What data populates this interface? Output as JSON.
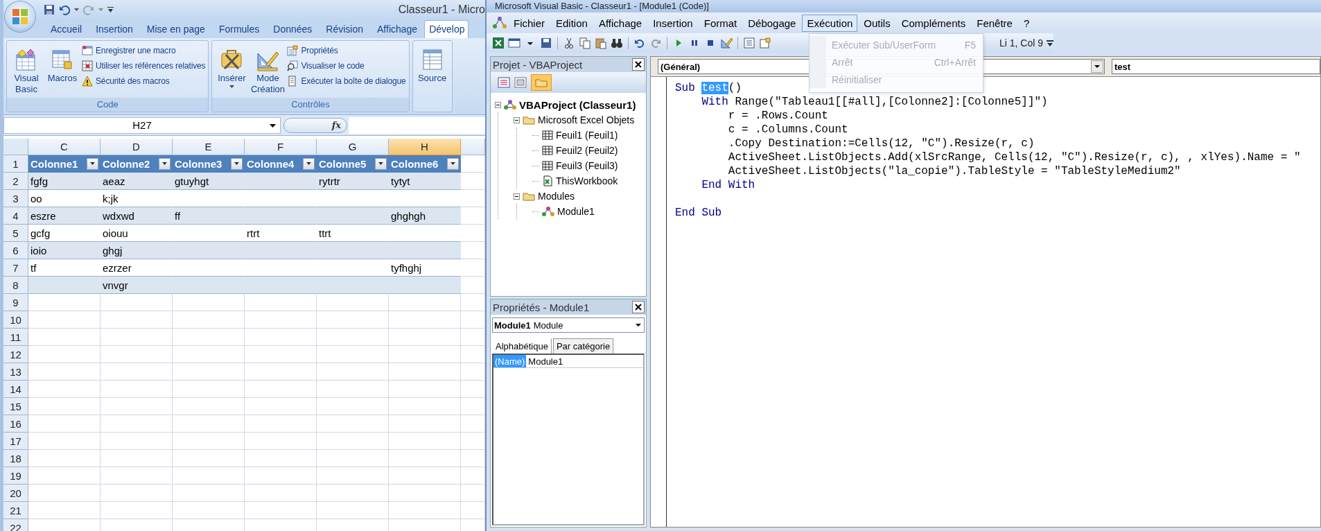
{
  "excel": {
    "title": "Classeur1 - Micro",
    "tabs": [
      {
        "label": "Accueil",
        "selected": false
      },
      {
        "label": "Insertion",
        "selected": false
      },
      {
        "label": "Mise en page",
        "selected": false
      },
      {
        "label": "Formules",
        "selected": false
      },
      {
        "label": "Données",
        "selected": false
      },
      {
        "label": "Révision",
        "selected": false
      },
      {
        "label": "Affichage",
        "selected": false
      },
      {
        "label": "Dévelop",
        "selected": true
      }
    ],
    "groups": [
      {
        "title": "Code",
        "large": [
          {
            "label": "Visual Basic",
            "kind": "vba"
          },
          {
            "label": "Macros",
            "kind": "macros"
          }
        ],
        "small": [
          {
            "label": "Enregistrer une macro",
            "kind": "record"
          },
          {
            "label": "Utiliser les références relatives",
            "kind": "relative"
          },
          {
            "label": "Sécurité des macros",
            "kind": "security"
          }
        ]
      },
      {
        "title": "Contrôles",
        "large": [
          {
            "label": "Insérer",
            "kind": "insert",
            "menu": true
          },
          {
            "label": "Mode Création",
            "kind": "design",
            "menu": false
          }
        ],
        "small": [
          {
            "label": "Propriétés",
            "kind": "properties"
          },
          {
            "label": "Visualiser le code",
            "kind": "view-code"
          },
          {
            "label": "Exécuter la boîte de dialogue",
            "kind": "dialog"
          }
        ]
      },
      {
        "large": [
          {
            "label": "Source",
            "kind": "source"
          }
        ]
      }
    ],
    "name_box": "H27",
    "formula_label": "fx",
    "sheet": {
      "columns": [
        {
          "label": "C",
          "selected": false
        },
        {
          "label": "D",
          "selected": false
        },
        {
          "label": "E",
          "selected": false
        },
        {
          "label": "F",
          "selected": false
        },
        {
          "label": "G",
          "selected": false
        },
        {
          "label": "H",
          "selected": true
        }
      ],
      "rows": [
        {
          "number": "1",
          "kind": "table-header",
          "cells": [
            "Colonne1",
            "Colonne2",
            "Colonne3",
            "Colonne4",
            "Colonne5",
            "Colonne6"
          ]
        },
        {
          "number": "2",
          "kind": "table-row",
          "banded": true,
          "cells": [
            "fgfg",
            "aeaz",
            "gtuyhgt",
            null,
            "rytrtr",
            "tytyt"
          ]
        },
        {
          "number": "3",
          "kind": "table-row",
          "banded": false,
          "cells": [
            "oo",
            "k;jk",
            null,
            null,
            null,
            null
          ]
        },
        {
          "number": "4",
          "kind": "table-row",
          "banded": true,
          "cells": [
            "eszre",
            "wdxwd",
            "ff",
            null,
            null,
            "ghghgh"
          ]
        },
        {
          "number": "5",
          "kind": "table-row",
          "banded": false,
          "cells": [
            "gcfg",
            "oiouu",
            null,
            "rtrt",
            "ttrt",
            null
          ]
        },
        {
          "number": "6",
          "kind": "table-row",
          "banded": true,
          "cells": [
            "ioio",
            "ghgj",
            null,
            null,
            null,
            null
          ]
        },
        {
          "number": "7",
          "kind": "table-row",
          "banded": false,
          "cells": [
            "tf",
            "ezrzer",
            null,
            null,
            null,
            "tyfhghj"
          ]
        },
        {
          "number": "8",
          "kind": "table-row",
          "banded": true,
          "cells": [
            null,
            "vnvgr",
            null,
            null,
            null,
            null
          ]
        },
        {
          "number": "9",
          "kind": "empty"
        },
        {
          "number": "10",
          "kind": "empty"
        },
        {
          "number": "11",
          "kind": "empty"
        },
        {
          "number": "12",
          "kind": "empty"
        },
        {
          "number": "13",
          "kind": "empty"
        },
        {
          "number": "14",
          "kind": "empty"
        },
        {
          "number": "15",
          "kind": "empty"
        },
        {
          "number": "16",
          "kind": "empty"
        },
        {
          "number": "17",
          "kind": "empty"
        },
        {
          "number": "18",
          "kind": "empty"
        },
        {
          "number": "19",
          "kind": "empty"
        },
        {
          "number": "20",
          "kind": "empty"
        },
        {
          "number": "21",
          "kind": "empty"
        },
        {
          "number": "22",
          "kind": "empty"
        }
      ]
    }
  },
  "vbe": {
    "title": "Microsoft Visual Basic - Classeur1 - [Module1 (Code)]",
    "menus": [
      {
        "label": "Fichier",
        "selected": false
      },
      {
        "label": "Edition",
        "selected": false
      },
      {
        "label": "Affichage",
        "selected": false
      },
      {
        "label": "Insertion",
        "selected": false
      },
      {
        "label": "Format",
        "selected": false
      },
      {
        "label": "Débogage",
        "selected": false
      },
      {
        "label": "Exécution",
        "selected": true
      },
      {
        "label": "Outils",
        "selected": false
      },
      {
        "label": "Compléments",
        "selected": false
      },
      {
        "label": "Fenêtre",
        "selected": false
      },
      {
        "label": "?",
        "selected": false
      }
    ],
    "open_menu": [
      {
        "label": "Exécuter Sub/UserForm",
        "shortcut": "F5"
      },
      {
        "label": "Arrêt",
        "shortcut": "Ctrl+Arrêt"
      },
      {
        "label": "Réinitialiser"
      }
    ],
    "position": "Li 1, Col 9",
    "project": {
      "title": "Projet - VBAProject",
      "folders_toggled": true,
      "tree": [
        {
          "label": "VBAProject (Classeur1)",
          "kind": "project",
          "expanded": true,
          "children": [
            {
              "label": "Microsoft Excel Objets",
              "kind": "folder",
              "expanded": true,
              "children": [
                {
                  "label": "Feuil1 (Feuil1)",
                  "kind": "sheet"
                },
                {
                  "label": "Feuil2 (Feuil2)",
                  "kind": "sheet"
                },
                {
                  "label": "Feuil3 (Feuil3)",
                  "kind": "sheet"
                },
                {
                  "label": "ThisWorkbook",
                  "kind": "workbook"
                }
              ]
            },
            {
              "label": "Modules",
              "kind": "folder",
              "expanded": true,
              "children": [
                {
                  "label": "Module1",
                  "kind": "module"
                }
              ]
            }
          ]
        }
      ]
    },
    "properties": {
      "title": "Propriétés - Module1",
      "object_name": "Module1",
      "object_type": "Module",
      "tabs": [
        {
          "label": "Alphabétique",
          "selected": true
        },
        {
          "label": "Par catégorie",
          "selected": false
        }
      ],
      "rows": [
        {
          "name": "(Name)",
          "value": "Module1",
          "selected": true
        }
      ]
    },
    "code": {
      "object": "(Général)",
      "procedure": "test",
      "lines": [
        {
          "kind": "code",
          "tokens": [
            {
              "text": "Sub ",
              "kind": "keyword"
            },
            {
              "text": "test",
              "kind": "selected"
            },
            {
              "text": "()",
              "kind": "plain"
            }
          ]
        },
        {
          "kind": "code",
          "tokens": [
            {
              "text": "    With",
              "kind": "keyword"
            },
            {
              "text": " Range(\"Tableau1[[#all],[Colonne2]:[Colonne5]]\")",
              "kind": "plain"
            }
          ]
        },
        {
          "kind": "code",
          "tokens": [
            {
              "text": "        r = .Rows.Count",
              "kind": "plain"
            }
          ]
        },
        {
          "kind": "code",
          "tokens": [
            {
              "text": "        c = .Columns.Count",
              "kind": "plain"
            }
          ]
        },
        {
          "kind": "code",
          "tokens": [
            {
              "text": "        .Copy Destination:=Cells(12, \"C\").Resize(r, c)",
              "kind": "plain"
            }
          ]
        },
        {
          "kind": "code",
          "tokens": [
            {
              "text": "        ActiveSheet.ListObjects.Add(xlSrcRange, Cells(12, \"C\").Resize(r, c), , xlYes).Name = \"",
              "kind": "plain"
            }
          ]
        },
        {
          "kind": "code",
          "tokens": [
            {
              "text": "        ActiveSheet.ListObjects(\"la_copie\").TableStyle = \"TableStyleMedium2\"",
              "kind": "plain"
            }
          ]
        },
        {
          "kind": "code",
          "tokens": [
            {
              "text": "    End With",
              "kind": "keyword"
            }
          ]
        },
        {
          "kind": "blank"
        },
        {
          "kind": "code",
          "tokens": [
            {
              "text": "End Sub",
              "kind": "keyword"
            }
          ]
        }
      ]
    }
  }
}
